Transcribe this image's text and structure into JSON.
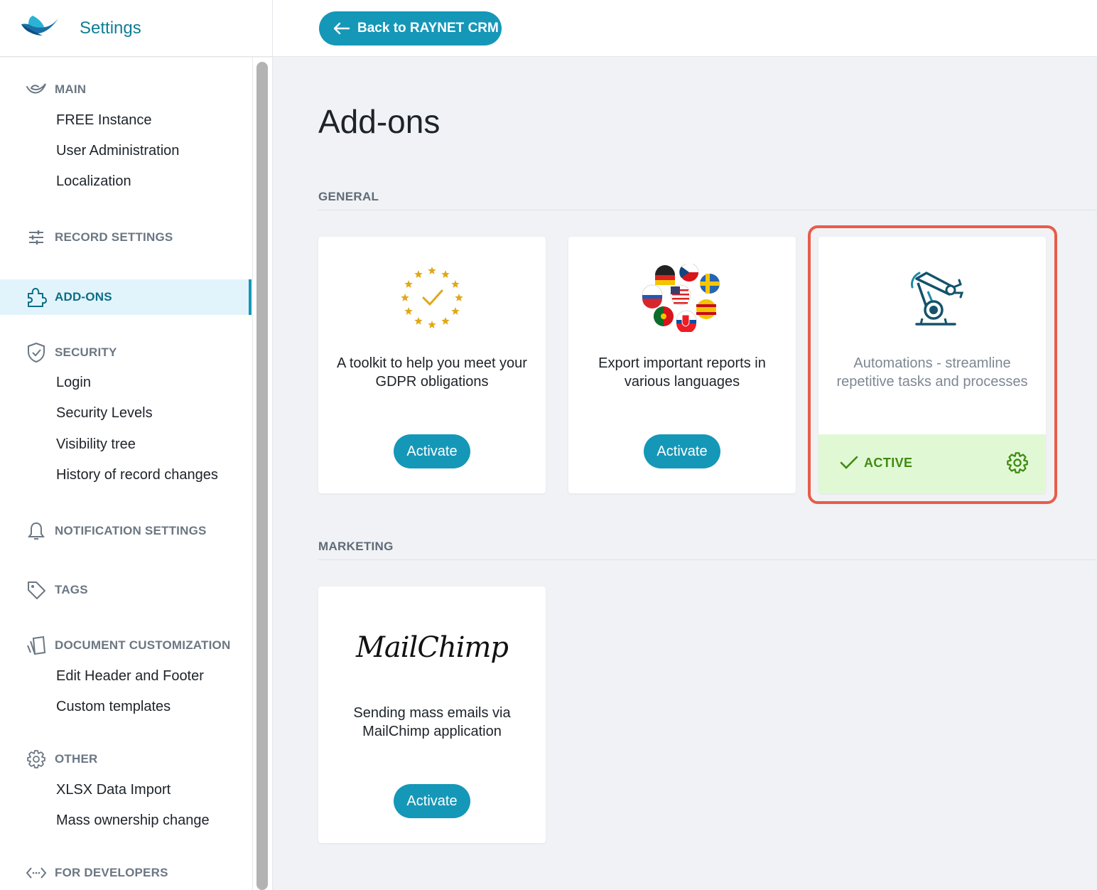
{
  "header": {
    "app_title": "Settings",
    "back_label": "Back to RAYNET CRM"
  },
  "sidebar": {
    "main": {
      "label": "MAIN",
      "items": [
        "FREE Instance",
        "User Administration",
        "Localization"
      ]
    },
    "record_settings": {
      "label": "RECORD SETTINGS"
    },
    "addons": {
      "label": "ADD-ONS"
    },
    "security": {
      "label": "SECURITY",
      "items": [
        "Login",
        "Security Levels",
        "Visibility tree",
        "History of record changes"
      ]
    },
    "notification_settings": {
      "label": "NOTIFICATION SETTINGS"
    },
    "tags": {
      "label": "TAGS"
    },
    "document_customization": {
      "label": "DOCUMENT CUSTOMIZATION",
      "items": [
        "Edit Header and Footer",
        "Custom templates"
      ]
    },
    "other": {
      "label": "OTHER",
      "items": [
        "XLSX Data Import",
        "Mass ownership change"
      ]
    },
    "for_developers": {
      "label": "FOR DEVELOPERS"
    }
  },
  "main": {
    "title": "Add-ons",
    "groups": [
      {
        "label": "GENERAL",
        "cards": [
          {
            "icon": "gdpr-stars-icon",
            "description": "A toolkit to help you meet your GDPR obligations",
            "button": "Activate"
          },
          {
            "icon": "language-flags-icon",
            "description": "Export important reports in various languages",
            "button": "Activate"
          },
          {
            "icon": "robot-arm-icon",
            "description": "Automations - streamline repetitive tasks and processes",
            "status": "ACTIVE"
          }
        ]
      },
      {
        "label": "MARKETING",
        "cards": [
          {
            "icon": "mailchimp-logo",
            "logo_text": "MailChimp",
            "description": "Sending mass emails via MailChimp application",
            "button": "Activate"
          }
        ]
      }
    ]
  },
  "colors": {
    "accent": "#1597b8",
    "active_bg": "#e1f8d5",
    "active_text": "#3f8c11",
    "highlight": "#e85c4a"
  }
}
